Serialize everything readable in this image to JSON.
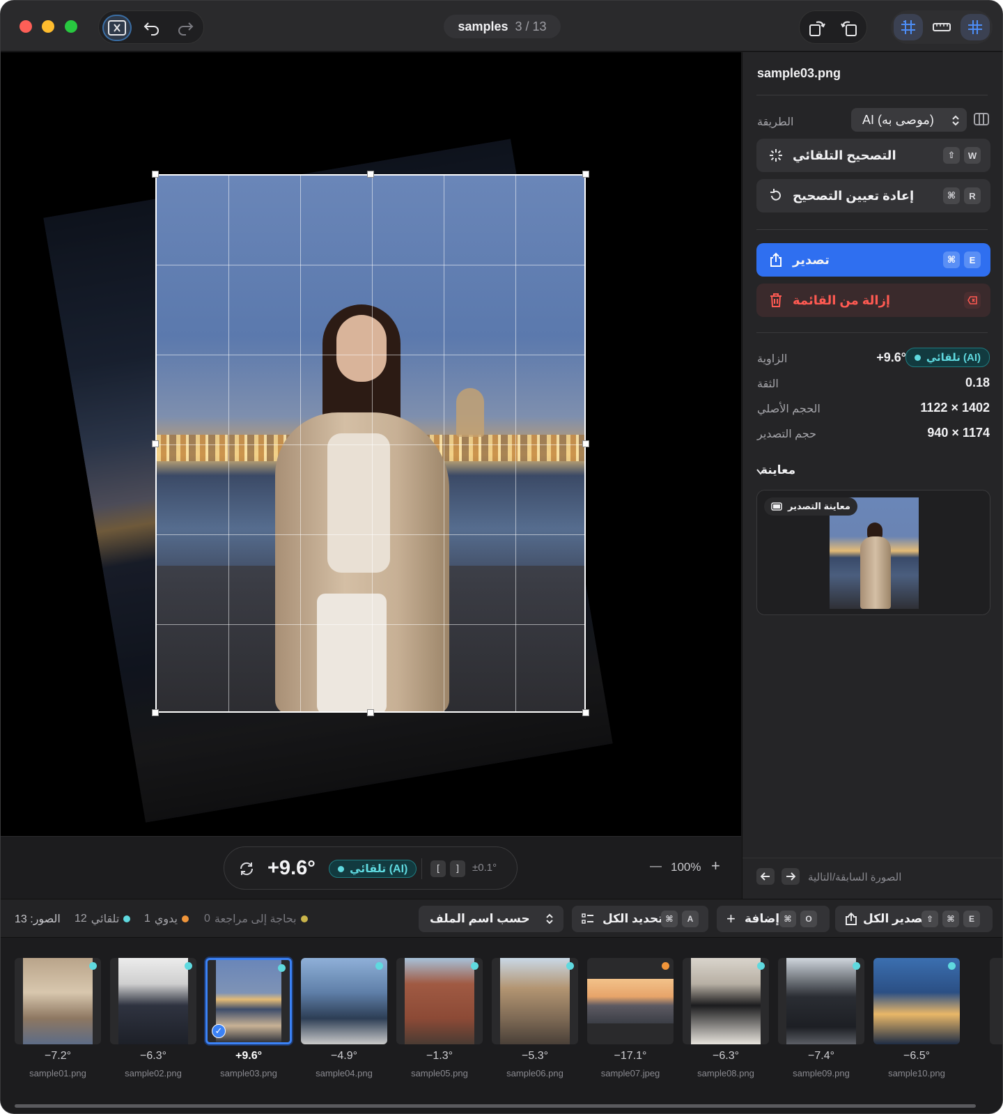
{
  "titlebar": {
    "folder": "samples",
    "position": "3 / 13"
  },
  "canvas": {
    "angle": "+9.6°",
    "mode_chip": "تلقائي (AI)",
    "nudge_left": "[",
    "nudge_right": "]",
    "step": "±0.1°",
    "zoom_out": "—",
    "zoom": "100%",
    "zoom_in": "+"
  },
  "panel": {
    "filename": "sample03.png",
    "method_label": "الطريقة",
    "method_value": "AI (موصى به)",
    "auto_fix": {
      "label": "التصحيح التلقائي",
      "keys": [
        "⇧",
        "W"
      ]
    },
    "reset": {
      "label": "إعادة تعيين التصحيح",
      "keys": [
        "⌘",
        "R"
      ]
    },
    "export": {
      "label": "تصدير",
      "keys": [
        "⌘",
        "E"
      ]
    },
    "remove": {
      "label": "إزالة من القائمة"
    },
    "info": [
      {
        "label": "الزاوية",
        "value": "+9.6°",
        "chip": "تلقائي (AI)"
      },
      {
        "label": "الثقة",
        "value": "0.18"
      },
      {
        "label": "الحجم الأصلي",
        "value": "1122 × 1402"
      },
      {
        "label": "حجم التصدير",
        "value": "940 × 1174"
      }
    ],
    "preview_section": "معاينة",
    "preview_chip": "معاينة التصدير",
    "nav_hint": "الصورة السابقة/التالية"
  },
  "toolbar": {
    "images_count": "الصور: 13",
    "auto_count": "12",
    "auto_label": "تلقائي",
    "manual_count": "1",
    "manual_label": "يدوي",
    "review_count": "0",
    "review_label": "بحاجة إلى مراجعة",
    "sort": "حسب اسم الملف",
    "select_all": {
      "label": "تحديد الكل",
      "keys": [
        "⌘",
        "A"
      ]
    },
    "add": {
      "label": "إضافة",
      "keys": [
        "⌘",
        "O"
      ]
    },
    "export_all": {
      "label": "تصدير الكل",
      "keys": [
        "⇧",
        "⌘",
        "E"
      ]
    }
  },
  "colors": {
    "accent": "#2f6ff0",
    "auto": "#5fd9df",
    "manual": "#f0953a",
    "review": "#c9b44a",
    "danger": "#ff5a52"
  },
  "thumbnails": [
    {
      "angle": "−7.2°",
      "name": "sample01.png",
      "status": "auto",
      "selected": false
    },
    {
      "angle": "−6.3°",
      "name": "sample02.png",
      "status": "auto",
      "selected": false
    },
    {
      "angle": "+9.6°",
      "name": "sample03.png",
      "status": "auto",
      "selected": true
    },
    {
      "angle": "−4.9°",
      "name": "sample04.png",
      "status": "auto",
      "selected": false
    },
    {
      "angle": "−1.3°",
      "name": "sample05.png",
      "status": "auto",
      "selected": false
    },
    {
      "angle": "−5.3°",
      "name": "sample06.png",
      "status": "auto",
      "selected": false
    },
    {
      "angle": "−17.1°",
      "name": "sample07.jpeg",
      "status": "manual",
      "selected": false
    },
    {
      "angle": "−6.3°",
      "name": "sample08.png",
      "status": "auto",
      "selected": false
    },
    {
      "angle": "−7.4°",
      "name": "sample09.png",
      "status": "auto",
      "selected": false
    },
    {
      "angle": "−6.5°",
      "name": "sample10.png",
      "status": "auto",
      "selected": false
    }
  ]
}
